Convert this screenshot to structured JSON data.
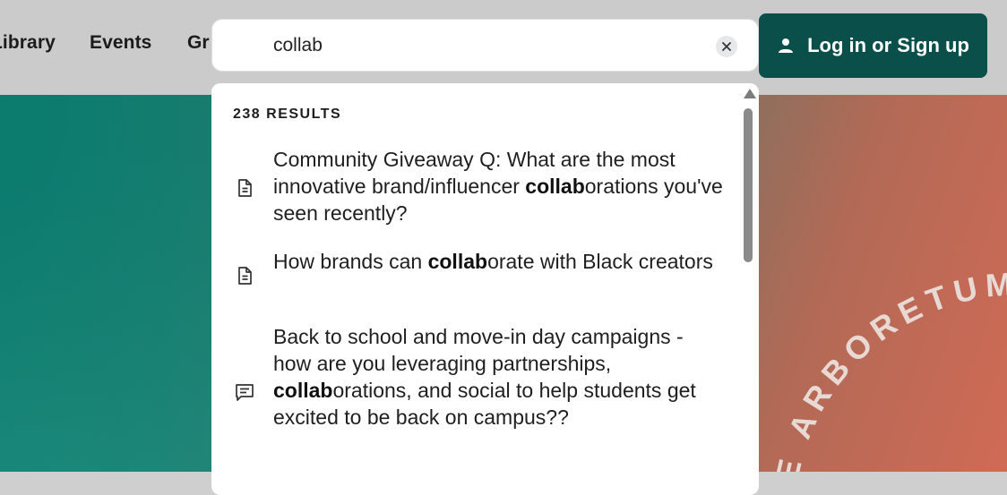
{
  "nav": {
    "library_label": "Library",
    "events_label": "Events",
    "groups_label": "Gr"
  },
  "search": {
    "value": "collab",
    "placeholder": "",
    "clear_icon": "close-icon"
  },
  "login": {
    "label": "Log in or Sign up",
    "icon": "person-icon"
  },
  "dropdown": {
    "results_count": "238 RESULTS",
    "results": [
      {
        "icon": "document-icon",
        "before": "Community Giveaway Q: What are the most innovative brand/influencer ",
        "match": "collab",
        "after": "orations you've seen recently?"
      },
      {
        "icon": "document-icon",
        "before": "How brands can ",
        "match": "collab",
        "after": "orate with Black creators"
      },
      {
        "icon": "comment-icon",
        "before": "Back to school and move-in day campaigns - how are you leveraging partnerships, ",
        "match": "collab",
        "after": "orations, and social to help students get excited to be back on campus??"
      }
    ]
  },
  "hero": {
    "arc_text": "E ARBORETUM"
  },
  "colors": {
    "login_bg": "#0b4f4a",
    "topbar_bg": "#cbcbcb"
  }
}
